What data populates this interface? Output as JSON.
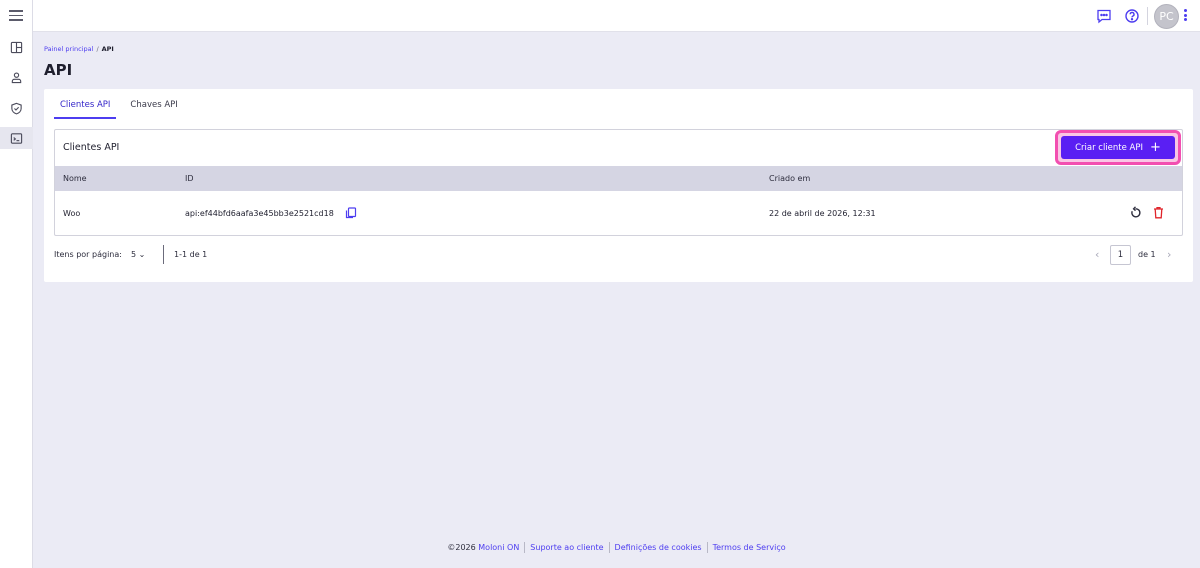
{
  "nav": {
    "items": [
      {
        "icon": "dashboard-icon"
      },
      {
        "icon": "user-icon"
      },
      {
        "icon": "shield-icon"
      },
      {
        "icon": "terminal-icon"
      }
    ]
  },
  "topbar": {
    "avatar_initials": "PC"
  },
  "breadcrumb": {
    "home": "Painel principal",
    "separator": "/",
    "current": "API"
  },
  "page_title": "API",
  "tabs": [
    {
      "label": "Clientes API",
      "active": true
    },
    {
      "label": "Chaves API",
      "active": false
    }
  ],
  "clients_section": {
    "title": "Clientes API",
    "create_button": "Criar cliente API",
    "create_icon": "+"
  },
  "table": {
    "columns": [
      "Nome",
      "ID",
      "Criado em"
    ],
    "rows": [
      {
        "name": "Woo",
        "id": "api:ef44bfd6aafa3e45bb3e2521cd18",
        "created": "22 de abril de 2026, 12:31"
      }
    ]
  },
  "pagination": {
    "per_page_label": "Itens por página:",
    "per_page_value": "5",
    "range": "1-1 de 1",
    "current_page": "1",
    "total_pages": "de 1",
    "prev": "‹",
    "next": "›"
  },
  "footer": {
    "copyright": "©2026",
    "links": [
      "Moloni ON",
      "Suporte ao cliente",
      "Definições de cookies",
      "Termos de Serviço"
    ]
  },
  "colors": {
    "accent": "#4d3df0",
    "button": "#5a1ff3",
    "highlight": "#f24fb0",
    "danger": "#e0252b"
  }
}
